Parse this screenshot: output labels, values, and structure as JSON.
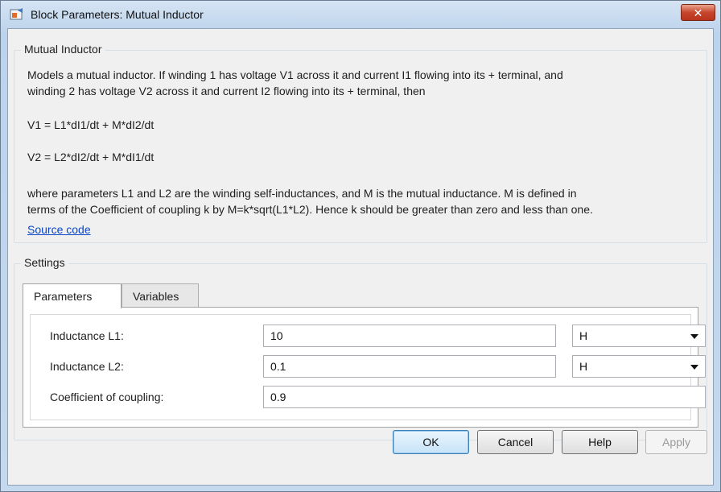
{
  "window": {
    "title": "Block Parameters: Mutual Inductor",
    "close_symbol": "✕"
  },
  "description": {
    "group_title": "Mutual Inductor",
    "intro_line1": "Models a mutual inductor. If winding 1 has voltage V1 across it and current I1 flowing into its + terminal, and",
    "intro_line2": "winding 2 has voltage V2 across it and current I2 flowing into its + terminal, then",
    "eq1": "V1 = L1*dI1/dt + M*dI2/dt",
    "eq2": "V2 = L2*dI2/dt + M*dI1/dt",
    "where_line1": "where parameters L1 and L2 are the winding self-inductances, and M is the mutual inductance. M is defined in",
    "where_line2": "terms of the Coefficient of coupling k by M=k*sqrt(L1*L2). Hence k should be greater than zero and less than one.",
    "source_link": "Source code"
  },
  "settings": {
    "group_title": "Settings",
    "tabs": [
      {
        "label": "Parameters",
        "active": true
      },
      {
        "label": "Variables",
        "active": false
      }
    ],
    "params": [
      {
        "label": "Inductance L1:",
        "value": "10",
        "unit": "H"
      },
      {
        "label": "Inductance L2:",
        "value": "0.1",
        "unit": "H"
      },
      {
        "label": "Coefficient of coupling:",
        "value": "0.9"
      }
    ]
  },
  "buttons": {
    "ok": "OK",
    "cancel": "Cancel",
    "help": "Help",
    "apply": "Apply"
  },
  "colors": {
    "link": "#0b47c5",
    "close_button": "#c7452c",
    "default_button_border": "#3c7fb1"
  }
}
